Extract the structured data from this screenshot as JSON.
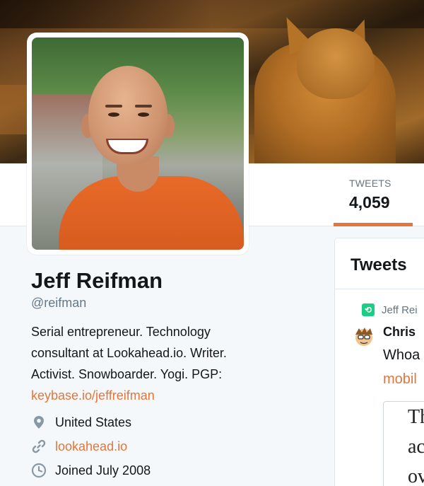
{
  "stats": {
    "tweets_label": "TWEETS",
    "tweets_count": "4,059"
  },
  "profile": {
    "name": "Jeff Reifman",
    "handle": "@reifman",
    "bio_lines": [
      "Serial entrepreneur. Technology",
      "consultant at Lookahead.io. Writer.",
      "Activist. Snowboarder. Yogi. PGP:"
    ],
    "bio_link": "keybase.io/jeffreifman",
    "location": "United States",
    "website": "lookahead.io",
    "joined": "Joined July 2008"
  },
  "timeline": {
    "title": "Tweets",
    "retweet_by": "Jeff Rei",
    "tweet_author": "Chris",
    "tweet_text": "Whoa",
    "tweet_link": "mobil",
    "card_lines": [
      "Th",
      "ac",
      "ov"
    ]
  },
  "colors": {
    "accent": "#e4753b",
    "retweet": "#19cf86"
  }
}
